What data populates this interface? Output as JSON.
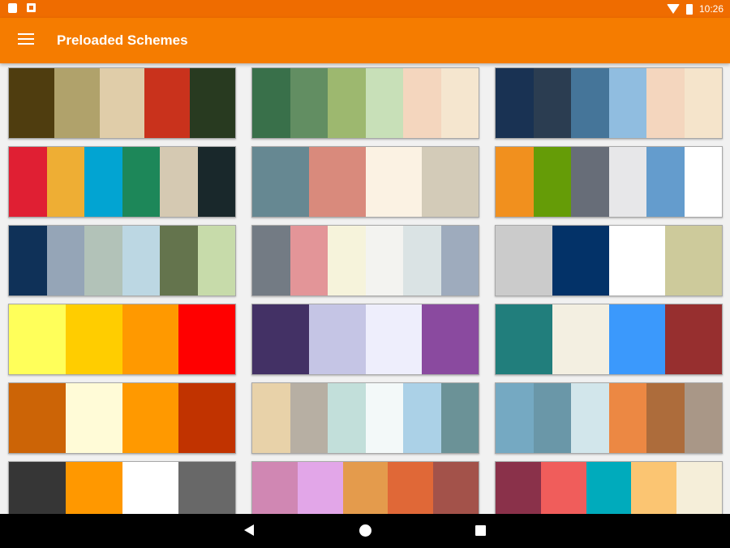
{
  "status_bar": {
    "time": "10:26",
    "icons": [
      "sd-card-icon",
      "photo-icon",
      "wifi-icon",
      "battery-icon"
    ]
  },
  "app_bar": {
    "title": "Preloaded Schemes",
    "menu_icon": "hamburger-menu-icon"
  },
  "schemes": [
    [
      "#4f3d0f",
      "#b0a26b",
      "#e0cda9",
      "#c9321c",
      "#283a20"
    ],
    [
      "#39704a",
      "#628e62",
      "#9db86f",
      "#c8e0b8",
      "#f4d6be",
      "#f5e6cf"
    ],
    [
      "#193253",
      "#2b3d51",
      "#457599",
      "#90bde0",
      "#f4d6be",
      "#f5e4cb"
    ],
    [
      "#e01f33",
      "#eeae34",
      "#02a4d2",
      "#1d8759",
      "#d5c9b2",
      "#19282b"
    ],
    [
      "#668892",
      "#d98a7c",
      "#fbf2e3",
      "#d3cbb8"
    ],
    [
      "#f1901e",
      "#659c07",
      "#676d78",
      "#e7e7e9",
      "#649ccd",
      "#ffffff"
    ],
    [
      "#0f3158",
      "#95a5b7",
      "#b2c2b8",
      "#bcd7e3",
      "#64744d",
      "#c7dbaa"
    ],
    [
      "#737b84",
      "#e39598",
      "#f6f3db",
      "#f3f3f0",
      "#dae3e4",
      "#9eabbd"
    ],
    [
      "#cbcbcb",
      "#033268",
      "#ffffff",
      "#cdca9b"
    ],
    [
      "#ffff5a",
      "#ffcd00",
      "#ff9900",
      "#ff0000"
    ],
    [
      "#433165",
      "#c5c5e5",
      "#eeeefc",
      "#8a4a9f"
    ],
    [
      "#217e7c",
      "#f3efe1",
      "#3b99fc",
      "#972f2f"
    ],
    [
      "#cc6406",
      "#fffbd7",
      "#ff9900",
      "#c13300"
    ],
    [
      "#e8d2a9",
      "#b7afa3",
      "#c2dfda",
      "#f3f9f9",
      "#abd1e7",
      "#6b9297"
    ],
    [
      "#75a9c2",
      "#6a97a8",
      "#d2e6eb",
      "#ec8843",
      "#ad6c3b",
      "#a99787"
    ],
    [
      "#363636",
      "#ff9800",
      "#ffffff",
      "#686868"
    ],
    [
      "#d087b3",
      "#e2a6e8",
      "#e49b4c",
      "#e06837",
      "#a3524a"
    ],
    [
      "#8a314a",
      "#f05d5b",
      "#00abbc",
      "#fbc572",
      "#f5eed9"
    ]
  ]
}
